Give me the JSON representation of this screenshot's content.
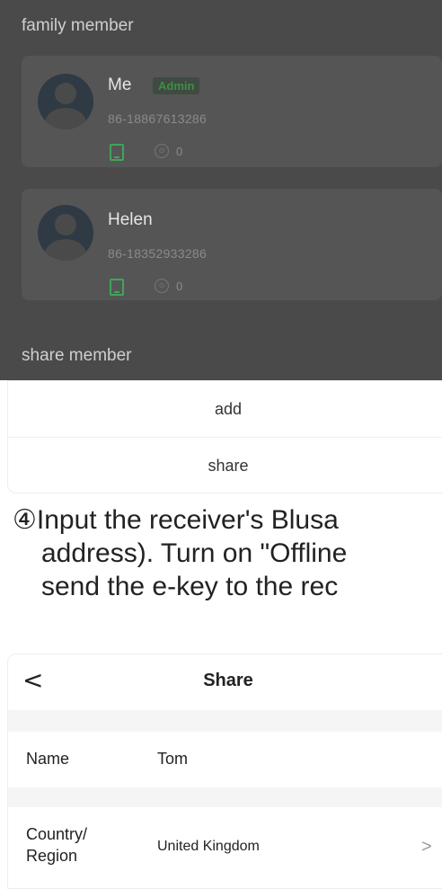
{
  "screen1": {
    "family_member_label": "family member",
    "members": [
      {
        "name": "Me",
        "badge": "Admin",
        "phone": "86-18867613286",
        "key_count": "0"
      },
      {
        "name": "Helen",
        "badge": "",
        "phone": "86-18352933286",
        "key_count": "0"
      }
    ],
    "share_member_label": "share member",
    "actions": {
      "add": "add",
      "share": "share"
    }
  },
  "instruction": {
    "line1": "④Input the receiver's Blusa",
    "line2": "address). Turn on \"Offline",
    "line3": "send the e-key to the rec"
  },
  "screen2": {
    "title": "Share",
    "back_glyph": "<",
    "fields": {
      "name_label": "Name",
      "name_value": "Tom",
      "country_label_1": "Country/",
      "country_label_2": "Region",
      "country_value": "United Kingdom"
    }
  }
}
